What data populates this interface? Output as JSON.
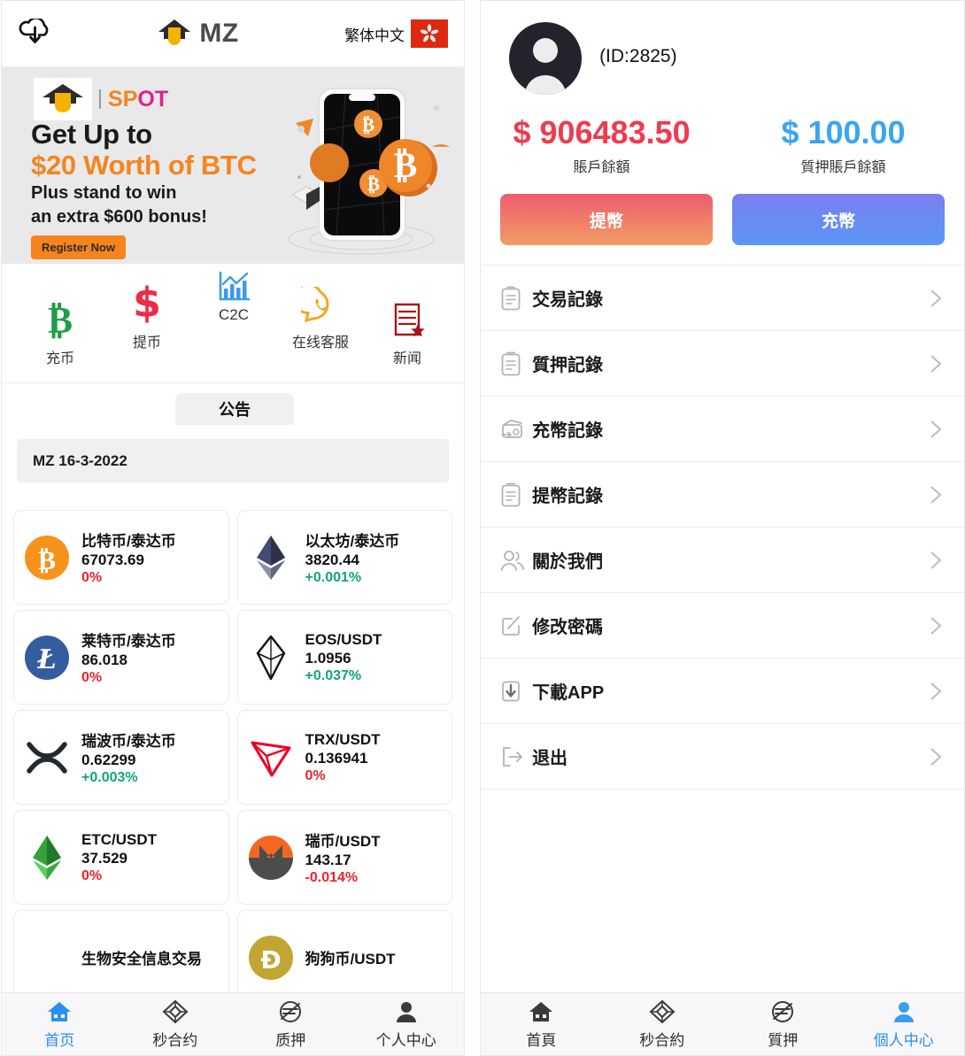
{
  "left": {
    "header": {
      "download_icon": "cloud-download-icon",
      "brand_text": "MZ",
      "language_label": "繁体中文",
      "flag": "hong-kong-flag"
    },
    "banner": {
      "logo_suffix": "SPOT",
      "line1": "Get Up to",
      "line2": "$20 Worth of BTC",
      "line3": "Plus stand to win",
      "line4": "an extra $600 bonus!",
      "cta": "Register Now",
      "accent": "#F5841F"
    },
    "quickmenu": [
      {
        "icon": "bitcoin-icon",
        "label": "充币"
      },
      {
        "icon": "dollar-icon",
        "label": "提币"
      },
      {
        "icon": "chart-icon",
        "label": "C2C"
      },
      {
        "icon": "whatsapp-icon",
        "label": "在线客服"
      },
      {
        "icon": "news-icon",
        "label": "新闻"
      }
    ],
    "announce": {
      "tab_label": "公告",
      "item": "MZ 16-3-2022"
    },
    "coins": [
      {
        "icon": "bitcoin-coin-icon",
        "name": "比特币/泰达币",
        "price": "67073.69",
        "change": "0%",
        "dir": "flat"
      },
      {
        "icon": "ethereum-coin-icon",
        "name": "以太坊/泰达币",
        "price": "3820.44",
        "change": "+0.001%",
        "dir": "up"
      },
      {
        "icon": "litecoin-coin-icon",
        "name": "莱特币/泰达币",
        "price": "86.018",
        "change": "0%",
        "dir": "flat"
      },
      {
        "icon": "eos-coin-icon",
        "name": "EOS/USDT",
        "price": "1.0956",
        "change": "+0.037%",
        "dir": "up"
      },
      {
        "icon": "ripple-coin-icon",
        "name": "瑞波币/泰达币",
        "price": "0.62299",
        "change": "+0.003%",
        "dir": "up"
      },
      {
        "icon": "tron-coin-icon",
        "name": "TRX/USDT",
        "price": "0.136941",
        "change": "0%",
        "dir": "flat"
      },
      {
        "icon": "etc-coin-icon",
        "name": "ETC/USDT",
        "price": "37.529",
        "change": "0%",
        "dir": "flat"
      },
      {
        "icon": "monero-coin-icon",
        "name": "瑞币/USDT",
        "price": "143.17",
        "change": "-0.014%",
        "dir": "down"
      },
      {
        "icon": "bio-coin-icon",
        "name": "生物安全信息交易",
        "price": "",
        "change": "",
        "dir": "flat"
      },
      {
        "icon": "dogecoin-coin-icon",
        "name": "狗狗币/USDT",
        "price": "",
        "change": "",
        "dir": "flat"
      }
    ],
    "bottomnav": [
      {
        "icon": "home-icon",
        "label": "首页",
        "active": true
      },
      {
        "icon": "contract-icon",
        "label": "秒合约",
        "active": false
      },
      {
        "icon": "stake-icon",
        "label": "质押",
        "active": false
      },
      {
        "icon": "person-icon",
        "label": "个人中心",
        "active": false
      }
    ]
  },
  "right": {
    "profile": {
      "avatar_icon": "user-avatar-icon",
      "user_id": "(ID:2825)",
      "balance_amount": "$ 906483.50",
      "balance_label": "賬戶餘額",
      "balance_color": "#ef3b4e",
      "stake_amount": "$ 100.00",
      "stake_label": "質押賬戶餘額",
      "stake_color": "#3aa4f5"
    },
    "actions": {
      "withdraw_label": "提幣",
      "deposit_label": "充幣"
    },
    "menu": [
      {
        "icon": "clipboard-icon",
        "label": "交易記錄"
      },
      {
        "icon": "clipboard-icon",
        "label": "質押記錄"
      },
      {
        "icon": "wallet-in-icon",
        "label": "充幣記錄"
      },
      {
        "icon": "clipboard-icon",
        "label": "提幣記錄"
      },
      {
        "icon": "people-icon",
        "label": "關於我們"
      },
      {
        "icon": "edit-square-icon",
        "label": "修改密碼"
      },
      {
        "icon": "download-box-icon",
        "label": "下載APP"
      },
      {
        "icon": "logout-icon",
        "label": "退出"
      }
    ],
    "bottomnav": [
      {
        "icon": "home-icon",
        "label": "首頁",
        "active": false
      },
      {
        "icon": "contract-icon",
        "label": "秒合約",
        "active": false
      },
      {
        "icon": "stake-icon",
        "label": "質押",
        "active": false
      },
      {
        "icon": "person-icon",
        "label": "個人中心",
        "active": true
      }
    ]
  }
}
